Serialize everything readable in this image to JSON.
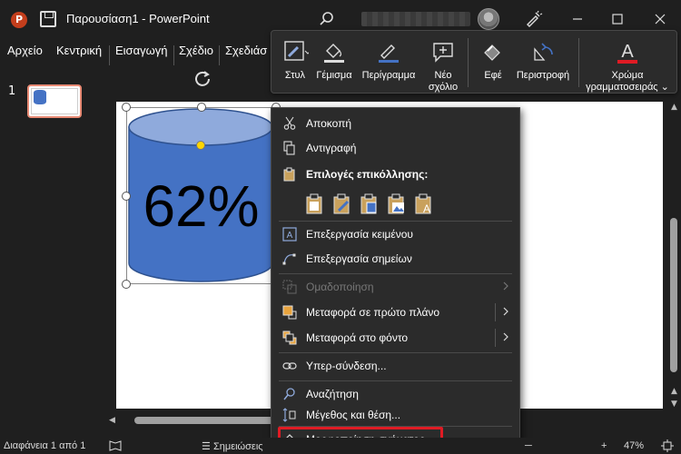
{
  "window": {
    "title": "Παρουσίαση1 - PowerPoint",
    "app_logo": "P"
  },
  "ribbon": {
    "tabs": [
      {
        "label": "Αρχείο"
      },
      {
        "label": "Κεντρική"
      },
      {
        "label": "Εισαγωγή"
      },
      {
        "label": "Σχέδιο"
      },
      {
        "label": "Σχεδιάσ"
      }
    ]
  },
  "mini_toolbar": {
    "items": [
      {
        "label": "Στυλ",
        "icon": "style-icon"
      },
      {
        "label": "Γέμισμα",
        "icon": "fill-bucket-icon"
      },
      {
        "label": "Περίγραμμα",
        "icon": "outline-pen-icon"
      },
      {
        "label": "Νέο\nσχόλιο",
        "line1": "Νέο",
        "line2": "σχόλιο",
        "icon": "new-comment-icon"
      },
      {
        "label": "Εφέ",
        "icon": "effects-icon"
      },
      {
        "label": "Περιστροφή",
        "icon": "rotate-icon"
      },
      {
        "label": "Χρώμα γραμματοσειράς",
        "line1": "Χρώμα",
        "line2": "γραμματοσειράς",
        "icon": "font-color-icon"
      }
    ],
    "font_color": "#e01b24"
  },
  "slides_panel": {
    "slide_number": "1"
  },
  "slide": {
    "shape_text": "62%",
    "shape_color": "#4472c4",
    "shape_top_color": "#8faadc"
  },
  "context_menu": {
    "items": {
      "cut": "Αποκοπή",
      "copy": "Αντιγραφή",
      "paste_options": "Επιλογές επικόλλησης:",
      "edit_text": "Επεξεργασία κειμένου",
      "edit_points": "Επεξεργασία σημείων",
      "group": "Ομαδοποίηση",
      "bring_to_front": "Μεταφορά σε πρώτο πλάνο",
      "send_to_back": "Μεταφορά στο φόντο",
      "hyperlink": "Υπερ-σύνδεση...",
      "search": "Αναζήτηση",
      "size_position": "Μέγεθος και θέση...",
      "format_shape": "Μορφοποίηση σχήματος..."
    },
    "highlight_color": "#e01b24"
  },
  "status_bar": {
    "slide_info": "Διαφάνεια 1 από 1",
    "notes": "Σημειώσεις",
    "zoom": "47%"
  }
}
